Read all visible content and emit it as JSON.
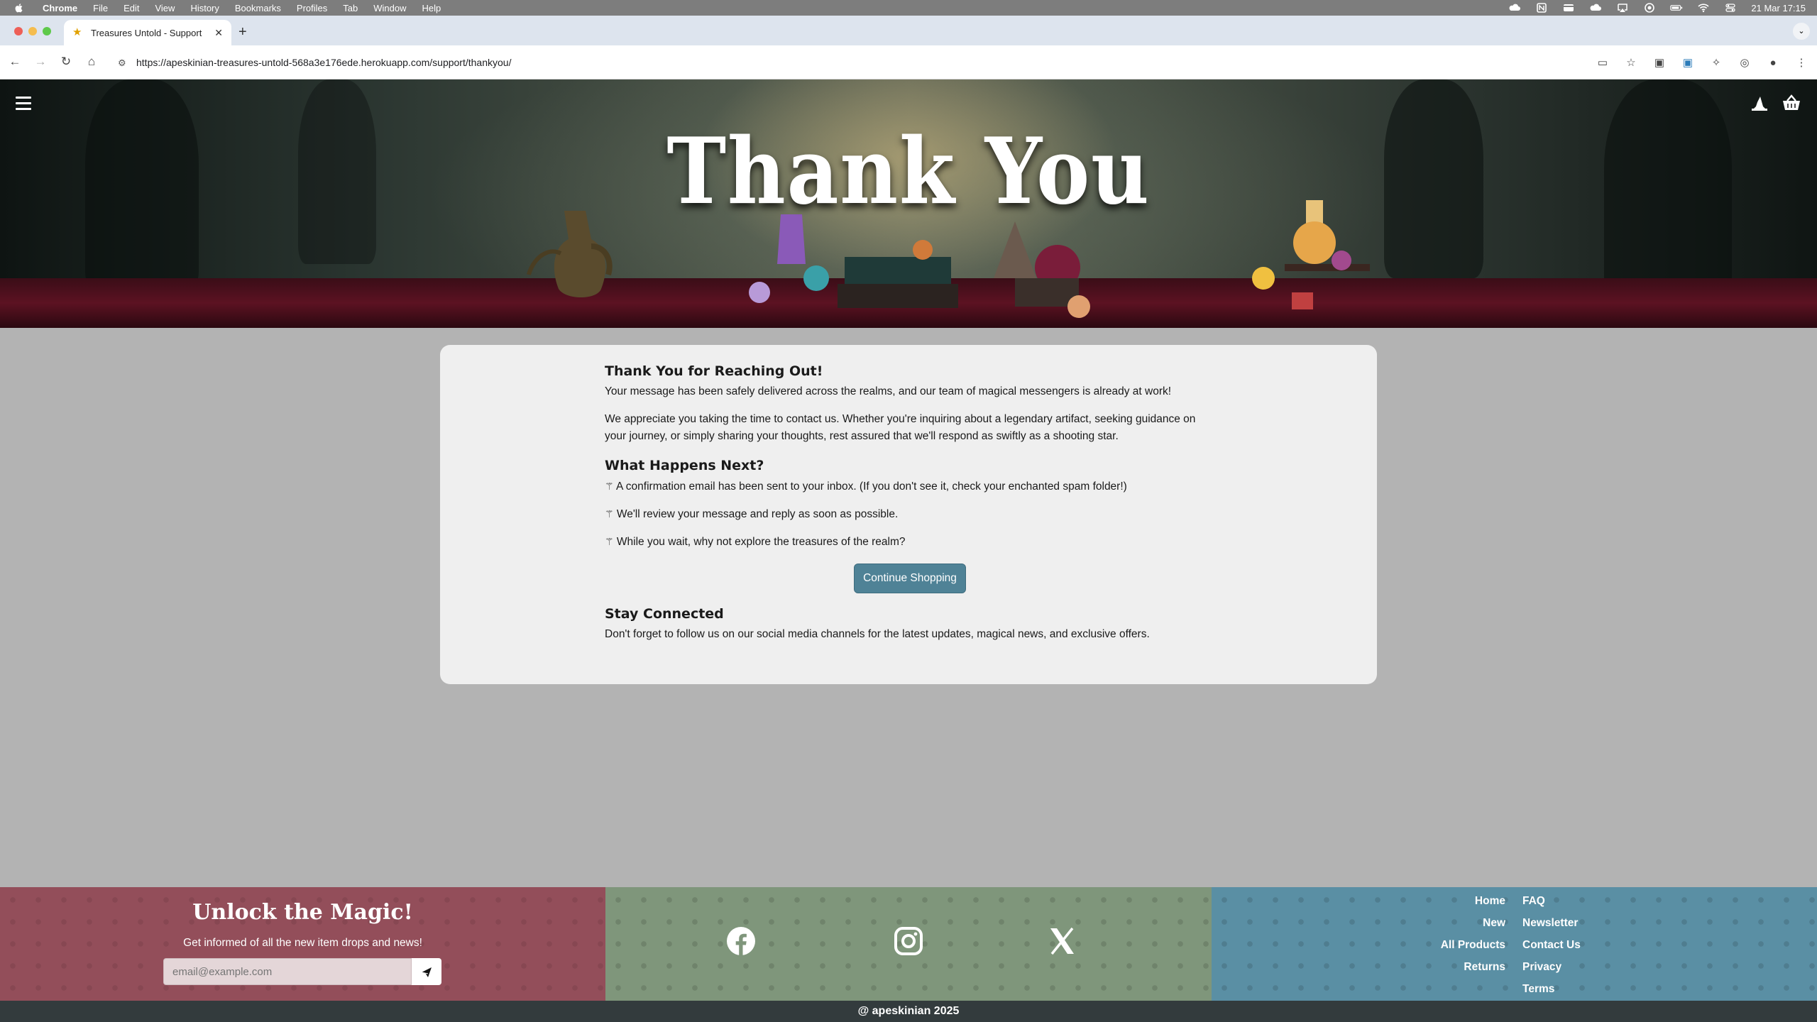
{
  "os_menubar": {
    "items": [
      "Chrome",
      "File",
      "Edit",
      "View",
      "History",
      "Bookmarks",
      "Profiles",
      "Tab",
      "Window",
      "Help"
    ],
    "datetime": "21 Mar  17:15"
  },
  "browser": {
    "tab_title": "Treasures Untold - Support",
    "url": "https://apeskinian-treasures-untold-568a3e176ede.herokuapp.com/support/thankyou/"
  },
  "hero": {
    "title": "Thank You"
  },
  "content": {
    "heading": "Thank You for Reaching Out!",
    "intro": "Your message has been safely delivered across the realms, and our team of magical messengers is already at work!",
    "appreciation": "We appreciate you taking the time to contact us. Whether you're inquiring about a legendary artifact, seeking guidance on your journey, or simply sharing your thoughts, rest assured that we'll respond as swiftly as a shooting star.",
    "next_heading": "What Happens Next?",
    "next_items": [
      "A confirmation email has been sent to your inbox. (If you don't see it, check your enchanted spam folder!)",
      "We'll review your message and reply as soon as possible.",
      "While you wait, why not explore the treasures of the realm?"
    ],
    "cta_label": "Continue Shopping",
    "connect_heading": "Stay Connected",
    "connect_text": "Don't forget to follow us on our social media channels for the latest updates, magical news, and exclusive offers."
  },
  "footer": {
    "newsletter_title": "Unlock the Magic!",
    "newsletter_subtitle": "Get informed of all the new item drops and news!",
    "email_placeholder": "email@example.com",
    "social_icons": [
      "facebook-icon",
      "instagram-icon",
      "x-icon"
    ],
    "links_left": [
      "Home",
      "New",
      "All Products",
      "Returns"
    ],
    "links_right": [
      "FAQ",
      "Newsletter",
      "Contact Us",
      "Privacy",
      "Terms"
    ],
    "copyright": "@ apeskinian 2025"
  },
  "colors": {
    "cta": "#4f8296",
    "footer_newsletter": "#934e5a",
    "footer_social": "#7f967b",
    "footer_links": "#5a8fa4",
    "copyright_bar": "#333b3d"
  }
}
